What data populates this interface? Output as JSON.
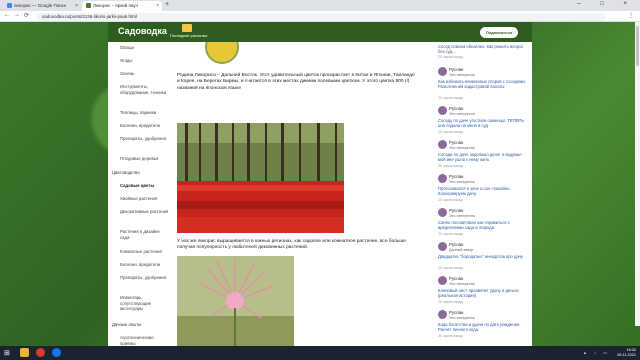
{
  "browser": {
    "tabs": [
      {
        "label": "пикорис — Google Поиск",
        "close": "×"
      },
      {
        "label": "Ликорис – яркий пауч",
        "close": "×"
      }
    ],
    "new_tab": "+",
    "window_controls": "– □ ×",
    "url": "sadovodka.ru/posts/2136-likoris-jarkii-pauk.html",
    "back": "←",
    "forward": "→",
    "reload": "⟳",
    "menu": "⋮"
  },
  "site": {
    "logo": "Садоводка",
    "folder_label": "Последние рассылки",
    "subscribe": "Подписаться"
  },
  "nav": {
    "items": [
      {
        "label": "Овощи"
      },
      {
        "label": "Ягоды"
      },
      {
        "label": "Зелень"
      },
      {
        "label": "Инструменты, оборудование, техника"
      },
      {
        "label": "Теплицы, парники"
      },
      {
        "label": "Болезни, вредители"
      },
      {
        "label": "Препараты, удобрения"
      },
      {
        "label": "Плодовые деревья"
      },
      {
        "label": "Цветоводство"
      },
      {
        "label": "Садовые цветы"
      },
      {
        "label": "Хвойные растения"
      },
      {
        "label": "Декоративные растения"
      },
      {
        "label": "Растения в дизайне сада"
      },
      {
        "label": "Комнатные растения"
      },
      {
        "label": "Болезни, вредители"
      },
      {
        "label": "Препараты, удобрения"
      },
      {
        "label": "Инвентарь, сопутствующие аксессуары"
      },
      {
        "label": "Дачные опыты"
      },
      {
        "label": "Агротехнические приёмы"
      }
    ]
  },
  "article": {
    "para1": "Родина Ликориса – Дальний Восток. Этот удивительный цветок произрастает в Китае и Японии, Таиланде и Корее, на Берегах Бирмы, и считается в этих местах дикими полевыми цветком. У этого цветка 900 (!) названий на японском языке",
    "para2": "У нас же ликорис выращивается в южных регионах, как садовое или комнатное растение, все больше получая популярность у любителей диковинных растений."
  },
  "comments": {
    "top_link": "Сосед совсем обнаглел. Как решить вопрос без суд...",
    "top_time": "20 часов назад",
    "items": [
      {
        "name": "Руслан",
        "sub": "Это интересно",
        "link": "Как избежать неимлевых споров с соседями: Разъяснения кадастровой палаты",
        "time": "20 часов назад"
      },
      {
        "name": "Руслан",
        "sub": "Это интересно",
        "link": "Соседу по даче угостили саженцы. ТЕПЕРЬ она подала на меня в суд",
        "time": "20 часов назад"
      },
      {
        "name": "Руслан",
        "sub": "Это интересно",
        "link": "Соседи по даче задолжал денег и вздумал мой ине ушла к нему жить",
        "time": "20 часов назад"
      },
      {
        "name": "Руслан",
        "sub": "Это интересно",
        "link": "Проголовался я зоне и сон спокойно. Консервируем дачу.",
        "time": "20 часов назад"
      },
      {
        "name": "Руслан",
        "sub": "Это интересно",
        "link": "Санно посоветовал как справиться с вредителями сада и огорода",
        "time": "20 часов назад"
      },
      {
        "name": "Руслан",
        "sub": "Дачный юмор",
        "link": "Двадцатка \"бородатых\" анекдотов про дачу",
        "time": "20 часов назад"
      },
      {
        "name": "Руслан",
        "sub": "Это интересно",
        "link": "Клеиовый лист проявляет удачу и деньги (реальная история)",
        "time": "20 часов назад"
      },
      {
        "name": "Руслан",
        "sub": "Это интересно",
        "link": "Кода богатства и удачи по дате рождения. Расчёт личного кода",
        "time": "20 часов назад"
      }
    ]
  },
  "taskbar": {
    "start": "⊞",
    "time": "18:32",
    "date": "06.11.2021"
  }
}
